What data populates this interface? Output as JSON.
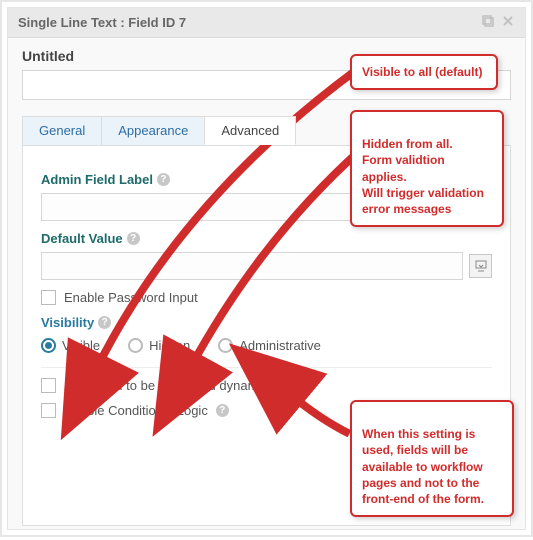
{
  "panel": {
    "title": "Single Line Text : Field ID 7",
    "field_title": "Untitled",
    "field_value": ""
  },
  "tabs": {
    "general": "General",
    "appearance": "Appearance",
    "advanced": "Advanced",
    "active": "advanced"
  },
  "advanced": {
    "admin_label": "Admin Field Label",
    "admin_label_value": "",
    "default_value_label": "Default Value",
    "default_value_value": "",
    "enable_password": "Enable Password Input",
    "visibility_label": "Visibility",
    "vis_visible": "Visible",
    "vis_hidden": "Hidden",
    "vis_admin": "Administrative",
    "vis_selected": "visible",
    "allow_populate": "Allow field to be populated dynamically",
    "conditional_logic": "Enable Conditional Logic"
  },
  "callouts": {
    "c1": "Visible to all (default)",
    "c2": "Hidden from all.\nForm validtion applies.\nWill trigger validation\nerror messages",
    "c3": "When this setting is\nused, fields will be\navailable to workflow\npages and not to  the\nfront-end of the form."
  },
  "colors": {
    "accent": "#2a7aa0",
    "callout": "#d12c2c"
  }
}
